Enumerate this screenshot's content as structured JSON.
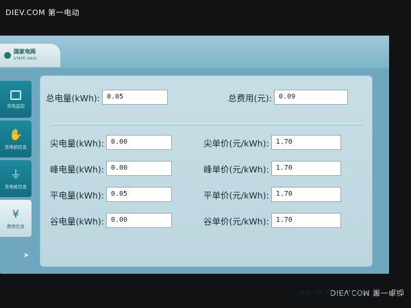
{
  "watermark": {
    "text": "DIEV.COM 第一电动"
  },
  "header": {
    "logo_cn": "国家电网",
    "logo_en": "STATE GRID"
  },
  "sidebar": {
    "items": [
      {
        "label": "充电监控",
        "icon": "pause-box-icon"
      },
      {
        "label": "充电机信息",
        "icon": "hand-card-icon"
      },
      {
        "label": "充电枪信息",
        "icon": "charger-plug-icon"
      },
      {
        "label": "费用信息",
        "icon": "yen-icon",
        "glyph": "¥",
        "active": true
      }
    ]
  },
  "summary": {
    "total_energy_label": "总电量(kWh):",
    "total_energy_value": "0.05",
    "total_cost_label": "总费用(元):",
    "total_cost_value": "0.09"
  },
  "energy": [
    {
      "label": "尖电量(kWh):",
      "value": "0.00"
    },
    {
      "label": "峰电量(kWh):",
      "value": "0.00"
    },
    {
      "label": "平电量(kWh):",
      "value": "0.05"
    },
    {
      "label": "谷电量(kWh):",
      "value": "0.00"
    }
  ],
  "prices": [
    {
      "label": "尖单价(元/kWh):",
      "value": "1.70"
    },
    {
      "label": "峰单价(元/kWh):",
      "value": "1.70"
    },
    {
      "label": "平单价(元/kWh):",
      "value": "1.70"
    },
    {
      "label": "谷单价(元/kWh):",
      "value": "1.70"
    }
  ],
  "status": {
    "timestamp": "2016-08-03 22:11:53"
  }
}
